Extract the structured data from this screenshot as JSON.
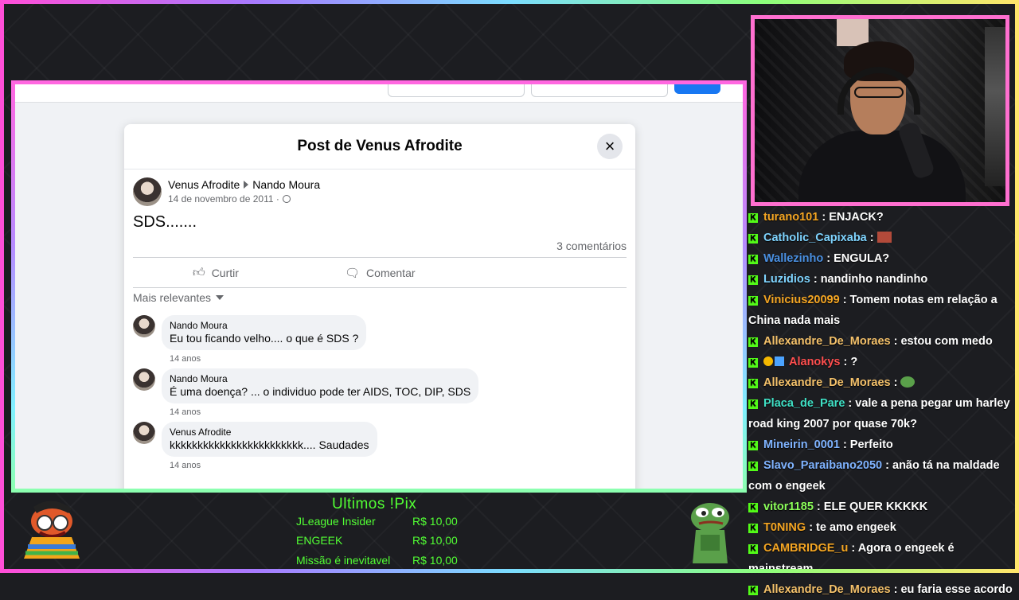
{
  "facebook": {
    "modal_title": "Post de Venus Afrodite",
    "close_symbol": "×",
    "post": {
      "author": "Venus Afrodite",
      "target": "Nando Moura",
      "date": "14 de novembro de 2011 ·",
      "text": "SDS.......",
      "comment_count": "3 comentários"
    },
    "actions": {
      "like": "Curtir",
      "comment": "Comentar"
    },
    "sort_label": "Mais relevantes",
    "comments": [
      {
        "name": "Nando Moura",
        "text": "Eu tou ficando velho.... o que é SDS ?",
        "time": "14 anos"
      },
      {
        "name": "Nando Moura",
        "text": "É uma doença? ... o individuo pode ter AIDS, TOC, DIP, SDS",
        "time": "14 anos"
      },
      {
        "name": "Venus Afrodite",
        "text": "kkkkkkkkkkkkkkkkkkkkkkkk.... Saudades",
        "time": "14 anos"
      }
    ]
  },
  "chat": {
    "messages": [
      {
        "user": "turano101",
        "color": "#f5a623",
        "text": " : ENJACK?"
      },
      {
        "user": "Catholic_Capixaba",
        "color": "#7fd4ff",
        "text": " : "
      },
      {
        "user": "Wallezinho",
        "color": "#4a90e2",
        "text": " : ENGULA?"
      },
      {
        "user": "Luzidios",
        "color": "#7fd4ff",
        "text": " : nandinho nandinho"
      },
      {
        "user": "Vinicius20099",
        "color": "#f5a623",
        "text": " : Tomem notas em relação a China nada mais"
      },
      {
        "user": "Allexandre_De_Moraes",
        "color": "#f5c26b",
        "text": " : estou com medo"
      },
      {
        "user": "Alanokys",
        "color": "#ff4f4f",
        "text": " : ?"
      },
      {
        "user": "Allexandre_De_Moraes",
        "color": "#f5c26b",
        "text": " : "
      },
      {
        "user": "Placa_de_Pare",
        "color": "#3fe0c5",
        "text": " : vale a pena pegar um harley road king 2007 por quase 70k?"
      },
      {
        "user": "Mineirin_0001",
        "color": "#7fb3ff",
        "text": " : Perfeito"
      },
      {
        "user": "Slavo_Paraibano2050",
        "color": "#7fb3ff",
        "text": " : anão tá na maldade com o engeek"
      },
      {
        "user": "vitor1185",
        "color": "#8cff5a",
        "text": " : ELE QUER KKKKK"
      },
      {
        "user": "T0NING",
        "color": "#f5a623",
        "text": " : te amo engeek"
      },
      {
        "user": "CAMBRIDGE_u",
        "color": "#f5a623",
        "text": " : Agora o engeek é mainstream"
      },
      {
        "user": "Allexandre_De_Moraes",
        "color": "#f5c26b",
        "text": " : eu faria esse acordo"
      }
    ]
  },
  "pix": {
    "title": "Ultimos !Pix",
    "rows": [
      {
        "name": "JLeague Insider",
        "value": "R$ 10,00"
      },
      {
        "name": "ENGEEK",
        "value": "R$ 10,00"
      },
      {
        "name": "Missão é inevitavel",
        "value": "R$ 10,00"
      }
    ]
  }
}
